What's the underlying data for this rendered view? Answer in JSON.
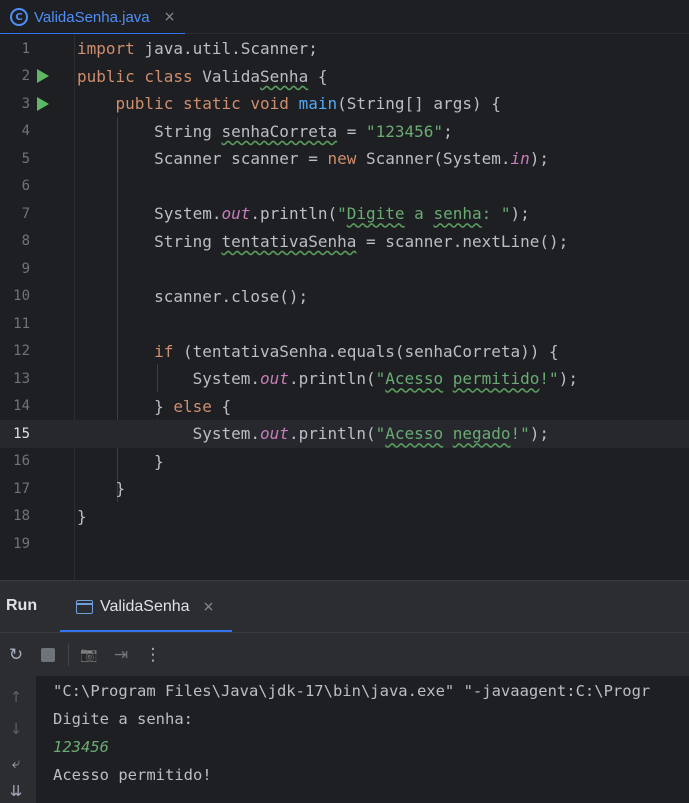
{
  "editor_tab": {
    "icon": "java-class-icon",
    "label": "ValidaSenha.java",
    "close": "×"
  },
  "code_lines": [
    {
      "num": "1",
      "tokens": [
        [
          "kw",
          "import"
        ],
        [
          "plain",
          " java.util.Scanner;"
        ]
      ]
    },
    {
      "num": "2",
      "run": true,
      "tokens": [
        [
          "kw",
          "public class"
        ],
        [
          "plain",
          " Valida"
        ],
        [
          "plainw",
          "Senha"
        ],
        [
          "plain",
          " {"
        ]
      ]
    },
    {
      "num": "3",
      "run": true,
      "tokens": [
        [
          "plain",
          "    "
        ],
        [
          "kw",
          "public static void"
        ],
        [
          "plain",
          " "
        ],
        [
          "fn",
          "main"
        ],
        [
          "plain",
          "(String[] args) {"
        ]
      ]
    },
    {
      "num": "4",
      "tokens": [
        [
          "plain",
          "        String "
        ],
        [
          "plainw",
          "senhaCorreta"
        ],
        [
          "plain",
          " = "
        ],
        [
          "str",
          "\"123456\""
        ],
        [
          "plain",
          ";"
        ]
      ]
    },
    {
      "num": "5",
      "tokens": [
        [
          "plain",
          "        Scanner scanner = "
        ],
        [
          "kw",
          "new"
        ],
        [
          "plain",
          " Scanner(System."
        ],
        [
          "field",
          "in"
        ],
        [
          "plain",
          ");"
        ]
      ]
    },
    {
      "num": "6",
      "tokens": []
    },
    {
      "num": "7",
      "tokens": [
        [
          "plain",
          "        System."
        ],
        [
          "field",
          "out"
        ],
        [
          "plain",
          ".println("
        ],
        [
          "str",
          "\""
        ],
        [
          "strw",
          "Digite"
        ],
        [
          "str",
          " a "
        ],
        [
          "strw",
          "senha"
        ],
        [
          "str",
          ": \""
        ],
        [
          "plain",
          ");"
        ]
      ]
    },
    {
      "num": "8",
      "tokens": [
        [
          "plain",
          "        String "
        ],
        [
          "plainw",
          "tentativaSenha"
        ],
        [
          "plain",
          " = scanner.nextLine();"
        ]
      ]
    },
    {
      "num": "9",
      "tokens": []
    },
    {
      "num": "10",
      "tokens": [
        [
          "plain",
          "        scanner.close();"
        ]
      ]
    },
    {
      "num": "11",
      "tokens": []
    },
    {
      "num": "12",
      "tokens": [
        [
          "plain",
          "        "
        ],
        [
          "kw",
          "if"
        ],
        [
          "plain",
          " (tentativaSenha.equals(senhaCorreta)) {"
        ]
      ]
    },
    {
      "num": "13",
      "tokens": [
        [
          "plain",
          "            System."
        ],
        [
          "field",
          "out"
        ],
        [
          "plain",
          ".println("
        ],
        [
          "str",
          "\""
        ],
        [
          "strw",
          "Acesso"
        ],
        [
          "str",
          " "
        ],
        [
          "strw",
          "permitido"
        ],
        [
          "str",
          "!\""
        ],
        [
          "plain",
          ");"
        ]
      ]
    },
    {
      "num": "14",
      "tokens": [
        [
          "plain",
          "        } "
        ],
        [
          "kw",
          "else"
        ],
        [
          "plain",
          " {"
        ]
      ]
    },
    {
      "num": "15",
      "current": true,
      "tokens": [
        [
          "plain",
          "            System."
        ],
        [
          "field",
          "out"
        ],
        [
          "plain",
          ".println("
        ],
        [
          "str",
          "\""
        ],
        [
          "strw",
          "Acesso"
        ],
        [
          "str",
          " "
        ],
        [
          "strw",
          "negado"
        ],
        [
          "str",
          "!\""
        ],
        [
          "plain",
          ");"
        ]
      ]
    },
    {
      "num": "16",
      "tokens": [
        [
          "plain",
          "        }"
        ]
      ]
    },
    {
      "num": "17",
      "tokens": [
        [
          "plain",
          "    }"
        ]
      ]
    },
    {
      "num": "18",
      "tokens": [
        [
          "plain",
          "}"
        ]
      ]
    },
    {
      "num": "19",
      "tokens": []
    }
  ],
  "run_panel": {
    "title": "Run",
    "tab_label": "ValidaSenha",
    "tab_close": "×",
    "toolbar": {
      "rerun": "↻",
      "camera": "📷",
      "exit": "⇥",
      "more": "⋮"
    },
    "side": {
      "up": "↑",
      "down": "↓",
      "wrap": "⤶",
      "scroll_end": "⇊"
    },
    "console_lines": [
      {
        "text": "\"C:\\Program Files\\Java\\jdk-17\\bin\\java.exe\" \"-javaagent:C:\\Progr",
        "kind": "cmd"
      },
      {
        "text": "Digite a senha:",
        "kind": "out"
      },
      {
        "text": "123456",
        "kind": "input"
      },
      {
        "text": "Acesso permitido!",
        "kind": "out"
      }
    ]
  },
  "colors": {
    "keyword": "#cf8e6d",
    "string": "#6aab73",
    "function": "#56a8f5",
    "field": "#c77dbb",
    "accent": "#3574f0"
  }
}
